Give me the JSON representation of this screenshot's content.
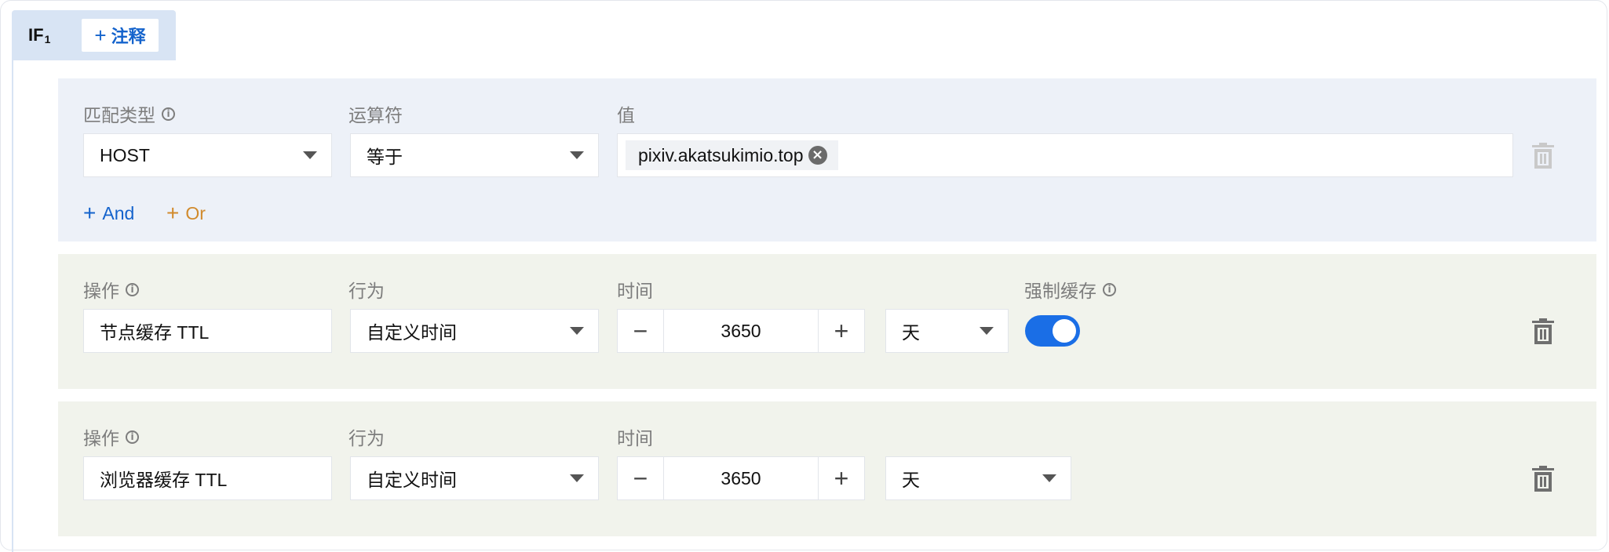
{
  "header": {
    "if_label": "IF",
    "if_index": "1",
    "add_note_label": "注释",
    "add_note_icon": "plus-icon"
  },
  "condition": {
    "match_type_label": "匹配类型",
    "operator_label": "运算符",
    "value_label": "值",
    "match_type_value": "HOST",
    "operator_value": "等于",
    "value_tags": [
      "pixiv.akatsukimio.top"
    ],
    "add_and_label": "And",
    "add_or_label": "Or",
    "and_color": "#1463cc",
    "or_color": "#d18a2c"
  },
  "actions": [
    {
      "operation_label": "操作",
      "behavior_label": "行为",
      "time_label": "时间",
      "force_cache_label": "强制缓存",
      "operation_value": "节点缓存 TTL",
      "behavior_value": "自定义时间",
      "time_value": "3650",
      "unit_value": "天",
      "force_cache_on": true
    },
    {
      "operation_label": "操作",
      "behavior_label": "行为",
      "time_label": "时间",
      "operation_value": "浏览器缓存 TTL",
      "behavior_value": "自定义时间",
      "time_value": "3650",
      "unit_value": "天"
    }
  ],
  "colors": {
    "accent": "#1463cc",
    "toggle_on": "#1a6ee6",
    "condition_bg": "#edf1f8",
    "action_bg": "#f1f3ec"
  }
}
